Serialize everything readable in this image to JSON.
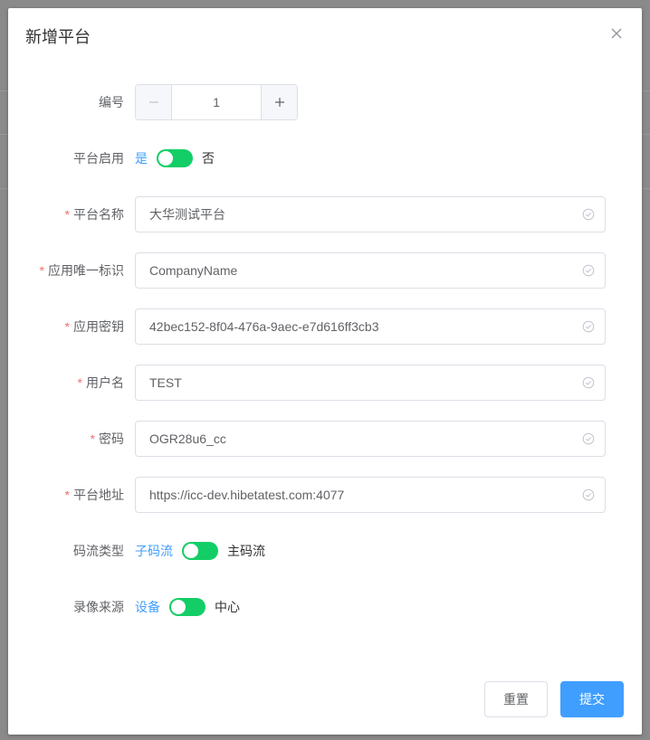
{
  "dialog": {
    "title": "新增平台"
  },
  "form": {
    "number": {
      "label": "编号",
      "value": "1"
    },
    "enabled": {
      "label": "平台启用",
      "on_text": "是",
      "off_text": "否",
      "checked": true
    },
    "name": {
      "label": "平台名称",
      "value": "大华测试平台",
      "required": true
    },
    "app_key": {
      "label": "应用唯一标识",
      "value": "CompanyName",
      "required": true
    },
    "app_secret": {
      "label": "应用密钥",
      "value": "42bec152-8f04-476a-9aec-e7d616ff3cb3",
      "required": true
    },
    "username": {
      "label": "用户名",
      "value": "TEST",
      "required": true
    },
    "password": {
      "label": "密码",
      "value": "OGR28u6_cc",
      "required": true
    },
    "address": {
      "label": "平台地址",
      "value": "https://icc-dev.hibetatest.com:4077",
      "required": true
    },
    "stream_type": {
      "label": "码流类型",
      "on_text": "子码流",
      "off_text": "主码流",
      "checked": true
    },
    "record_source": {
      "label": "录像来源",
      "on_text": "设备",
      "off_text": "中心",
      "checked": true
    }
  },
  "footer": {
    "reset_label": "重置",
    "submit_label": "提交"
  },
  "colors": {
    "primary": "#409eff",
    "switch_on": "#13ce66",
    "required": "#f56c6c"
  },
  "icons": {
    "close": "close-icon",
    "valid": "circle-check-icon",
    "minus": "minus-icon",
    "plus": "plus-icon"
  }
}
